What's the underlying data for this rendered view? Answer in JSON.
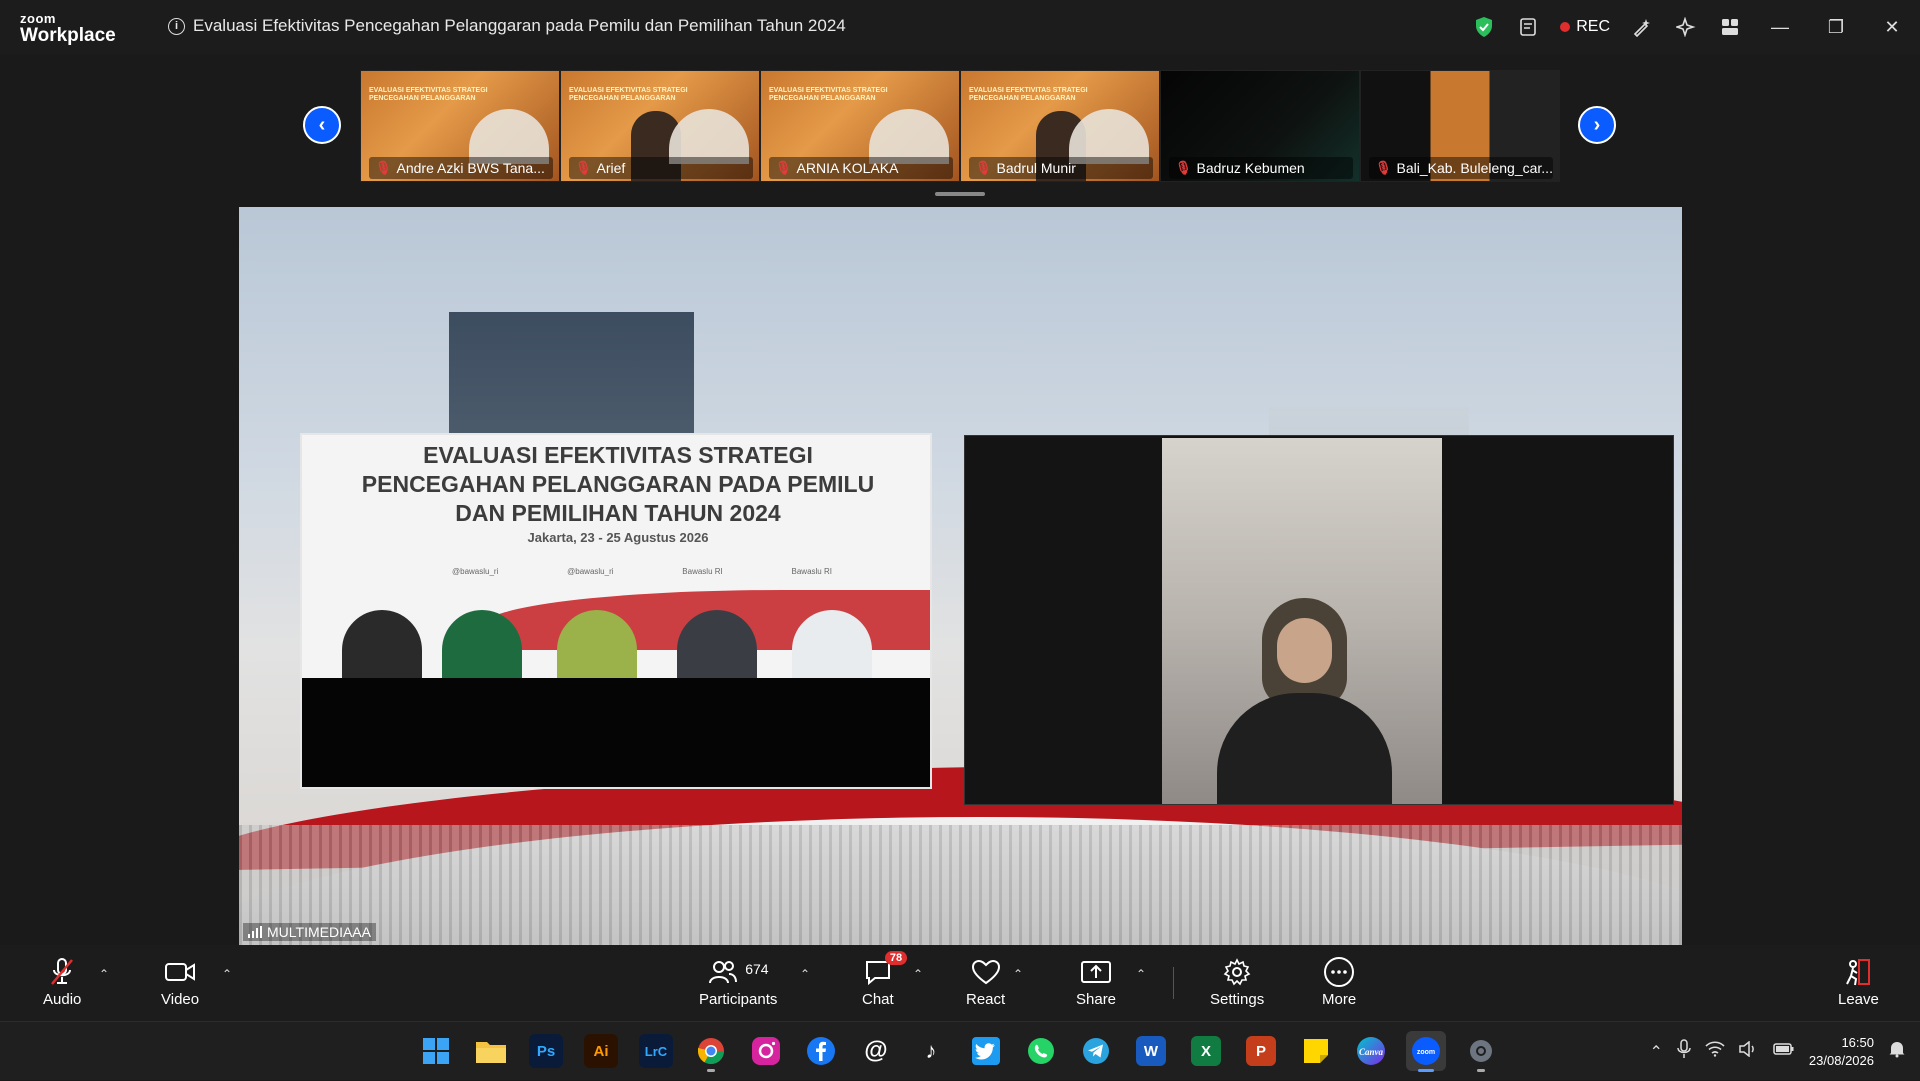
{
  "app": {
    "logo_top": "zoom",
    "logo_bottom": "Workplace"
  },
  "meeting": {
    "title": "Evaluasi Efektivitas Pencegahan Pelanggaran pada Pemilu dan Pemilihan Tahun 2024",
    "rec_label": "REC"
  },
  "colors": {
    "accent": "#0b5cff",
    "rec": "#e02d2d",
    "shield": "#2bbf5c",
    "badge": "#e02d2d"
  },
  "thumbnails": [
    {
      "name": "Andre Azki BWS Tana...",
      "muted": true
    },
    {
      "name": "Arief",
      "muted": true
    },
    {
      "name": "ARNIA KOLAKA",
      "muted": true
    },
    {
      "name": "Badrul Munir",
      "muted": true
    },
    {
      "name": "Badruz Kebumen",
      "muted": true
    },
    {
      "name": "Bali_Kab. Buleleng_car...",
      "muted": true
    }
  ],
  "slide": {
    "title_line1": "EVALUASI EFEKTIVITAS STRATEGI",
    "title_line2": "PENCEGAHAN PELANGGARAN PADA PEMILU",
    "title_line3": "DAN PEMILIHAN TAHUN 2024",
    "date": "Jakarta, 23 - 25 Agustus 2026",
    "social": [
      "@bawaslu_ri",
      "@bawaslu_ri",
      "Bawaslu RI",
      "Bawaslu RI"
    ]
  },
  "main_video": {
    "speaker_label": "MULTIMEDIAAA"
  },
  "controls": {
    "audio": "Audio",
    "video": "Video",
    "participants": "Participants",
    "participants_count": "674",
    "chat": "Chat",
    "chat_badge": "78",
    "react": "React",
    "share": "Share",
    "settings": "Settings",
    "more": "More",
    "leave": "Leave"
  },
  "taskbar": {
    "apps": [
      "windows-start",
      "file-explorer",
      "Ps",
      "Ai",
      "LrC",
      "chrome",
      "instagram",
      "facebook",
      "threads",
      "tiktok",
      "twitter",
      "whatsapp",
      "telegram",
      "word",
      "excel",
      "powerpoint",
      "sticky-notes",
      "Canva",
      "zoom",
      "settings"
    ],
    "time": "16:50",
    "date": "23/08/2026"
  }
}
